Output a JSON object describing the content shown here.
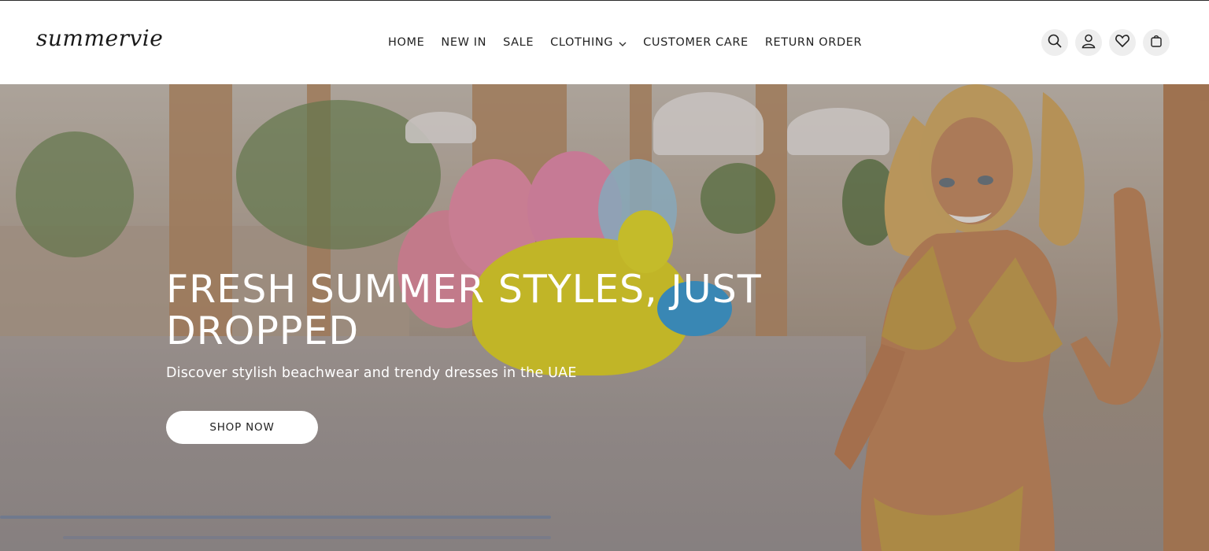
{
  "brand": {
    "logo_text": "summervie"
  },
  "nav": {
    "items": [
      {
        "label": "HOME"
      },
      {
        "label": "NEW IN"
      },
      {
        "label": "SALE"
      },
      {
        "label": "CLOTHING"
      },
      {
        "label": "CUSTOMER CARE"
      },
      {
        "label": "RETURN ORDER"
      }
    ],
    "dropdown_icon": "chevron-down-icon"
  },
  "header_icons": [
    "search-icon",
    "account-icon",
    "wishlist-heart-icon",
    "cart-icon"
  ],
  "hero": {
    "title": "FRESH SUMMER STYLES, JUST DROPPED",
    "subtitle": "Discover stylish beachwear and trendy dresses in the UAE",
    "cta_label": "SHOP NOW"
  },
  "colors": {
    "header_bg": "#ffffff",
    "icon_bg": "#eeeeee",
    "text": "#222222",
    "hero_text": "#ffffff"
  }
}
